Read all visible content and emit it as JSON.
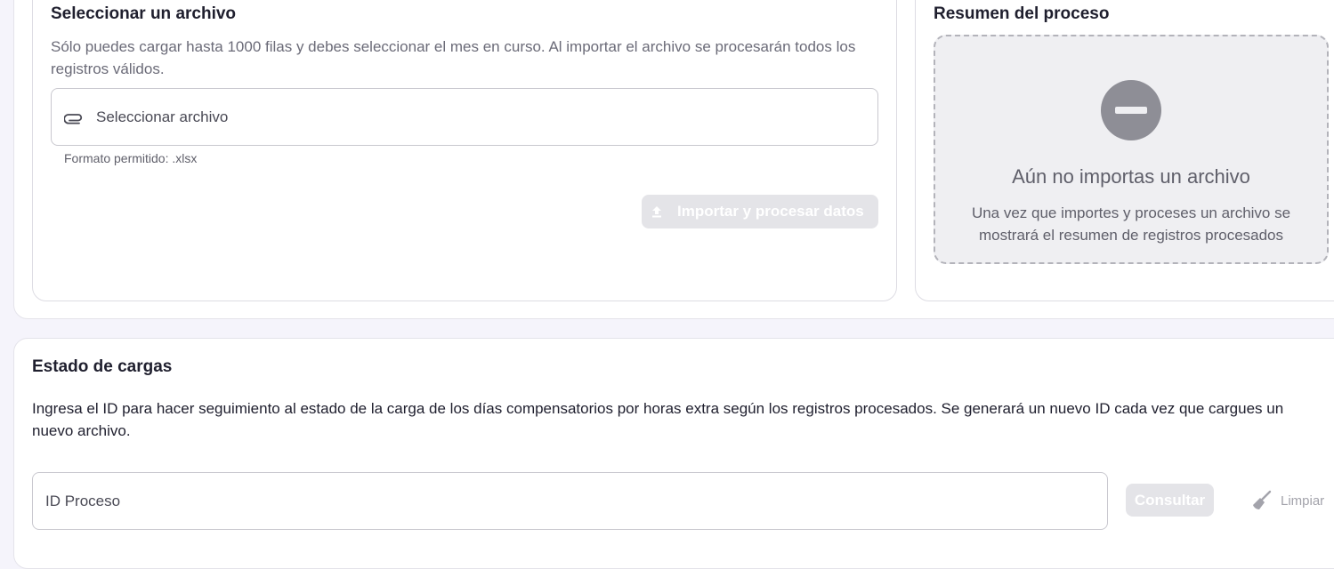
{
  "upload": {
    "title": "Seleccionar un archivo",
    "description": "Sólo puedes cargar hasta 1000 filas y debes seleccionar el mes en curso. Al importar el archivo se procesarán todos los registros válidos.",
    "file_button_label": "Seleccionar archivo",
    "file_icon": "paperclip-icon",
    "helper": "Formato permitido: .xlsx",
    "import_button_label": "Importar y procesar datos",
    "import_icon": "upload-icon"
  },
  "summary": {
    "title": "Resumen del proceso",
    "empty_icon": "minus-circle-icon",
    "empty_title": "Aún no importas un archivo",
    "empty_description": "Una vez que importes y proceses un archivo se mostrará el resumen de registros procesados"
  },
  "status": {
    "title": "Estado de cargas",
    "description": "Ingresa el ID para hacer seguimiento al estado de la carga de los días compensatorios por horas extra según los registros procesados. Se generará un nuevo ID cada vez que cargues un nuevo archivo.",
    "id_placeholder": "ID Proceso",
    "consult_label": "Consultar",
    "clear_label": "Limpiar",
    "clear_icon": "broom-icon"
  },
  "colors": {
    "page_bg": "#f5f4fb",
    "card_bg": "#ffffff",
    "disabled_button": "#e4e4e8",
    "empty_icon": "#8e8e96"
  }
}
